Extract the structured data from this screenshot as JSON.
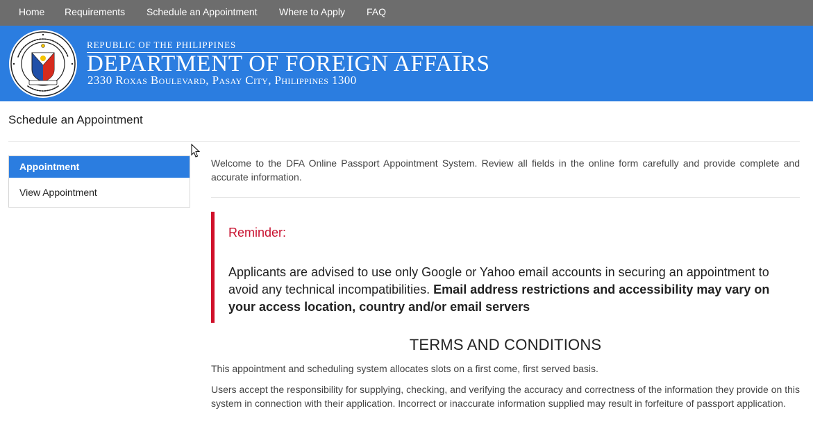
{
  "nav": {
    "items": [
      {
        "label": "Home"
      },
      {
        "label": "Requirements"
      },
      {
        "label": "Schedule an Appointment"
      },
      {
        "label": "Where to Apply"
      },
      {
        "label": "FAQ"
      }
    ]
  },
  "banner": {
    "subtitle": "Republic of the Philippines",
    "title": "DEPARTMENT OF FOREIGN AFFAIRS",
    "address": "2330 Roxas Boulevard, Pasay City, Philippines 1300",
    "seal_icon": "dfa-seal-icon"
  },
  "page": {
    "title": "Schedule an Appointment"
  },
  "sidebar": {
    "items": [
      {
        "label": "Appointment"
      },
      {
        "label": "View Appointment"
      }
    ]
  },
  "main": {
    "welcome": "Welcome to the DFA Online Passport Appointment System. Review all fields in the online form carefully and provide complete and accurate information.",
    "reminder": {
      "title": "Reminder:",
      "text": "Applicants are advised to use only Google or Yahoo email accounts in securing an appointment to avoid any technical incompatibilities.",
      "bold_text": "Email address restrictions and accessibility may vary on your access location, country and/or email servers"
    },
    "terms": {
      "title": "TERMS AND CONDITIONS",
      "p1": "This appointment and scheduling system allocates slots on a first come, first served basis.",
      "p2": "Users accept the responsibility for supplying, checking, and verifying the accuracy and correctness of the information they provide on this system in connection with their application. Incorrect or inaccurate information supplied may result in forfeiture of passport application."
    }
  },
  "colors": {
    "nav_bg": "#6d6d6d",
    "brand_blue": "#2b7de0",
    "reminder_red": "#c8102e"
  }
}
